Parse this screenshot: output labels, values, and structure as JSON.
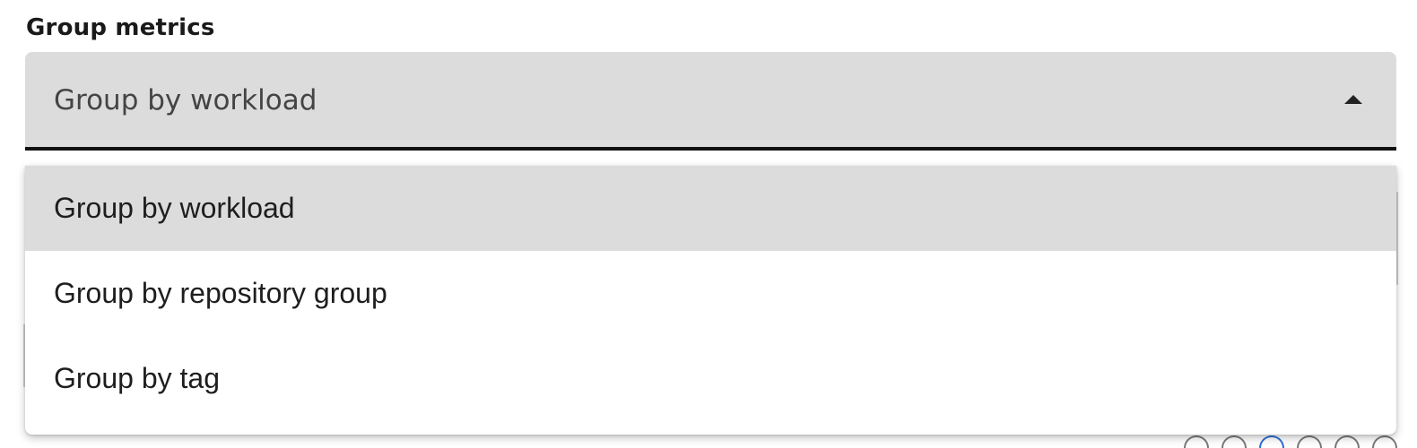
{
  "group_metrics": {
    "label": "Group metrics",
    "selected_value": "Group by workload",
    "caret_icon": "caret-up-icon",
    "options": [
      {
        "label": "Group by workload",
        "selected": true
      },
      {
        "label": "Group by repository group",
        "selected": false
      },
      {
        "label": "Group by tag",
        "selected": false
      }
    ]
  },
  "colors": {
    "field_background": "#dcdcdc",
    "field_underline": "#111111",
    "selected_option_background": "#dcdcdc",
    "menu_background": "#ffffff"
  }
}
